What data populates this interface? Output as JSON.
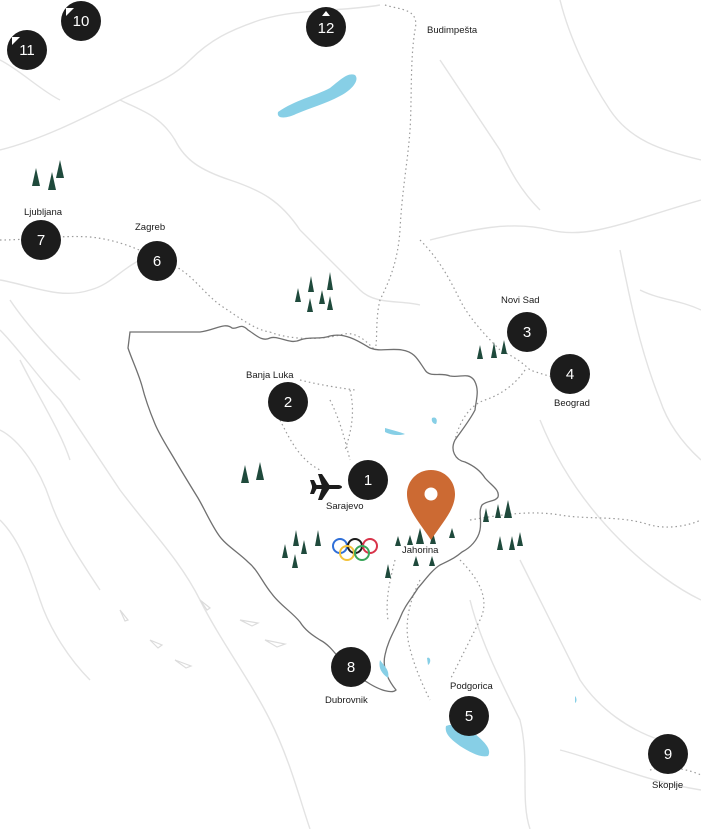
{
  "map": {
    "colors": {
      "land_border": "#e3e3e3",
      "bih_border": "#707070",
      "dotted_border": "#9a9a9a",
      "water": "#87cfe6",
      "marker_fill": "#1c1c1c",
      "pin": "#cc6a33",
      "tree": "#1f4a3c"
    },
    "markers": [
      {
        "number": "1",
        "label": "Sarajevo"
      },
      {
        "number": "2",
        "label": "Banja Luka"
      },
      {
        "number": "3",
        "label": "Novi Sad"
      },
      {
        "number": "4",
        "label": "Beograd"
      },
      {
        "number": "5",
        "label": "Podgorica"
      },
      {
        "number": "6",
        "label": "Zagreb"
      },
      {
        "number": "7",
        "label": "Ljubljana"
      },
      {
        "number": "8",
        "label": "Dubrovnik"
      },
      {
        "number": "9",
        "label": "Skoplje"
      },
      {
        "number": "10",
        "label": ""
      },
      {
        "number": "11",
        "label": ""
      },
      {
        "number": "12",
        "label": "Budimpešta"
      }
    ],
    "pin": {
      "label": "Jahorina",
      "icon": "location-pin-icon"
    },
    "icons": {
      "airport": "airplane-icon",
      "olympics": "olympic-rings-icon",
      "forest": "tree-icon"
    }
  }
}
